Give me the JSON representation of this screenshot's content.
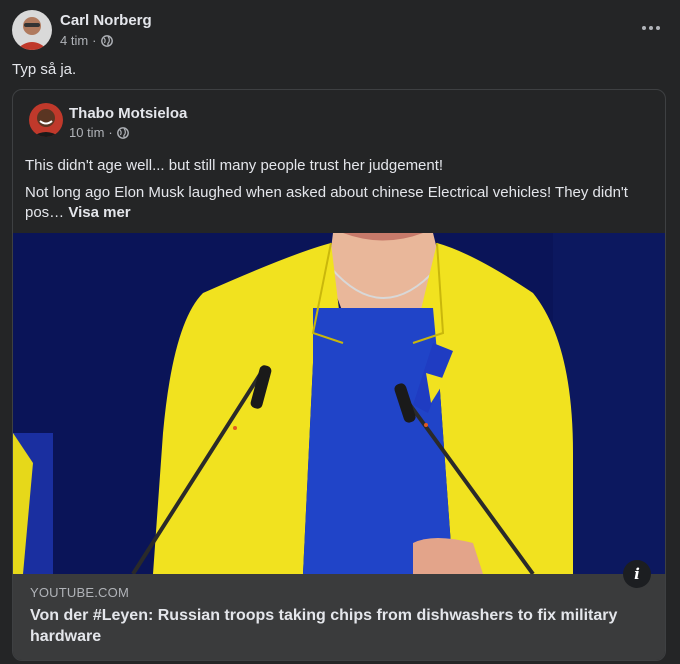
{
  "post": {
    "author": "Carl Norberg",
    "time": "4 tim",
    "separator": "·",
    "text": "Typ så ja.",
    "more_icon": "more-horizontal-icon",
    "audience_icon": "globe-icon"
  },
  "shared": {
    "author": "Thabo Motsieloa",
    "time": "10 tim",
    "separator": "·",
    "line1": "This didn't age well... but still many people trust her judgement!",
    "line2": "Not long ago Elon Musk laughed when asked about chinese Electrical vehicles! They didn't pos…",
    "see_more": "Visa mer"
  },
  "link": {
    "domain": "YOUTUBE.COM",
    "title": "Von der #Leyen: Russian troops taking chips from dishwashers to fix military hardware",
    "info_icon": "info-icon",
    "info_glyph": "i"
  },
  "colors": {
    "background": "#242526",
    "card_footer": "#3a3b3c",
    "jacket": "#f1e21f",
    "blue_backdrop": "#0a1458"
  }
}
